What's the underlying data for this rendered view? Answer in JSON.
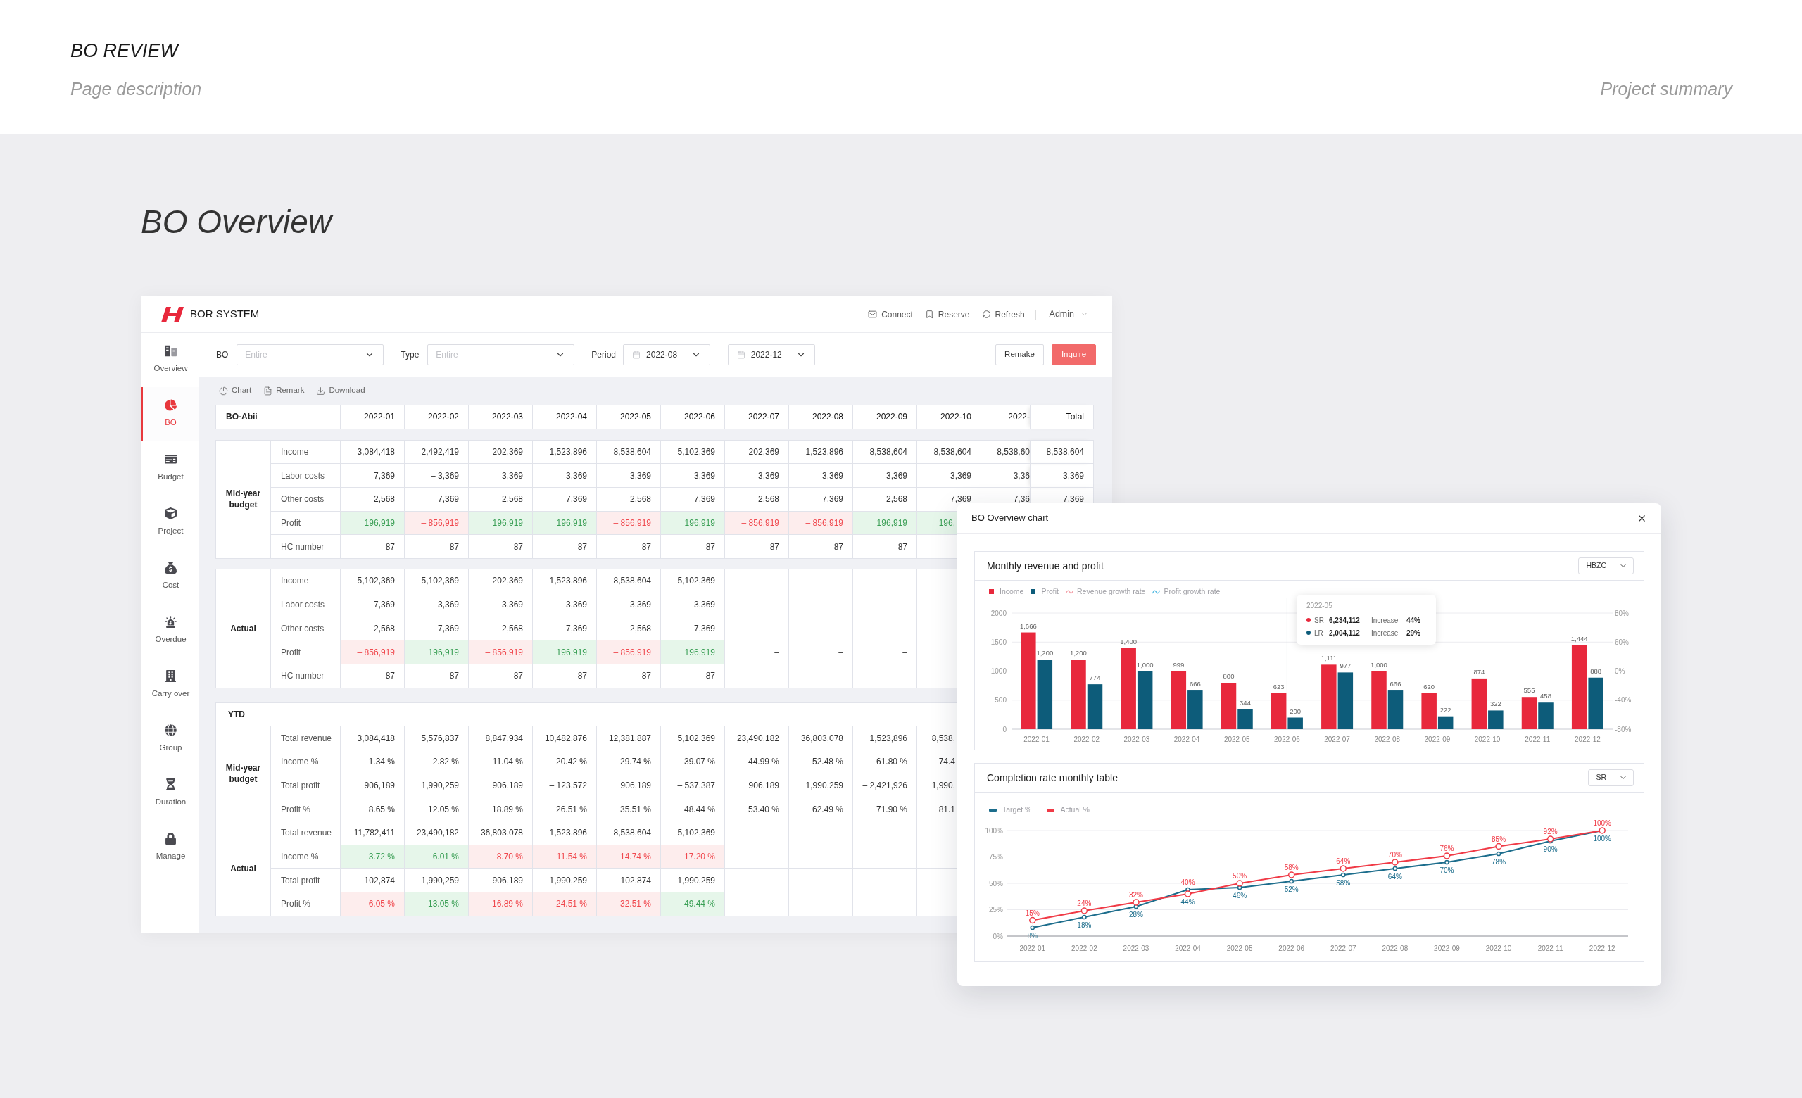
{
  "page": {
    "title": "BO REVIEW",
    "description": "Page description",
    "summary": "Project summary",
    "section_title": "BO Overview"
  },
  "app": {
    "header": {
      "brand": "BOR SYSTEM",
      "actions": [
        "Connect",
        "Reserve",
        "Refresh"
      ],
      "user": "Admin"
    },
    "sidebar": {
      "items": [
        {
          "label": "Overview",
          "selected": false
        },
        {
          "label": "BO",
          "selected": true
        },
        {
          "label": "Budget",
          "selected": false
        },
        {
          "label": "Project",
          "selected": false
        },
        {
          "label": "Cost",
          "selected": false
        },
        {
          "label": "Overdue",
          "selected": false
        },
        {
          "label": "Carry over",
          "selected": false
        },
        {
          "label": "Group",
          "selected": false
        },
        {
          "label": "Duration",
          "selected": false
        },
        {
          "label": "Manage",
          "selected": false
        }
      ]
    },
    "filters": {
      "bo": {
        "label": "BO",
        "placeholder": "Entire"
      },
      "type": {
        "label": "Type",
        "placeholder": "Entire"
      },
      "period": {
        "label": "Period",
        "from": "2022-08",
        "separator": "–",
        "to": "2022-12"
      },
      "buttons": [
        {
          "label": "Remake",
          "kind": "secondary"
        },
        {
          "label": "Inquire",
          "kind": "primary"
        }
      ]
    },
    "toolbar": [
      "Chart",
      "Remark",
      "Download"
    ],
    "table": {
      "columns": [
        "BO-Abii",
        "2022-01",
        "2022-02",
        "2022-03",
        "2022-04",
        "2022-05",
        "2022-06",
        "2022-07",
        "2022-08",
        "2022-09",
        "2022-10",
        "2022-",
        "Total"
      ],
      "blocks": [
        {
          "group": "Mid-year budget",
          "rows": [
            {
              "label": "Income",
              "values": [
                "3,084,418",
                "2,492,419",
                "202,369",
                "1,523,896",
                "8,538,604",
                "5,102,369",
                "202,369",
                "1,523,896",
                "8,538,604",
                "8,538,604",
                "8,538,60",
                "8,538,604"
              ]
            },
            {
              "label": "Labor costs",
              "values": [
                "7,369",
                "– 3,369",
                "3,369",
                "3,369",
                "3,369",
                "3,369",
                "3,369",
                "3,369",
                "3,369",
                "3,369",
                "3,36",
                "3,369"
              ]
            },
            {
              "label": "Other costs",
              "values": [
                "2,568",
                "7,369",
                "2,568",
                "7,369",
                "2,568",
                "7,369",
                "2,568",
                "7,369",
                "2,568",
                "7,369",
                "7,36",
                "7,369"
              ]
            },
            {
              "label": "Profit",
              "values": [
                "196,919",
                "– 856,919",
                "196,919",
                "196,919",
                "– 856,919",
                "196,919",
                "– 856,919",
                "– 856,919",
                "196,919",
                "196,"
              ],
              "positive": [
                true,
                false,
                true,
                true,
                false,
                true,
                false,
                false,
                true,
                true
              ]
            },
            {
              "label": "HC number",
              "values": [
                "87",
                "87",
                "87",
                "87",
                "87",
                "87",
                "87",
                "87",
                "87"
              ]
            }
          ]
        },
        {
          "group": "Actual",
          "rows": [
            {
              "label": "Income",
              "values": [
                "– 5,102,369",
                "5,102,369",
                "202,369",
                "1,523,896",
                "8,538,604",
                "5,102,369",
                "–",
                "–",
                "–"
              ]
            },
            {
              "label": "Labor costs",
              "values": [
                "7,369",
                "– 3,369",
                "3,369",
                "3,369",
                "3,369",
                "3,369",
                "–",
                "–",
                "–"
              ]
            },
            {
              "label": "Other costs",
              "values": [
                "2,568",
                "7,369",
                "2,568",
                "7,369",
                "2,568",
                "7,369",
                "–",
                "–",
                "–"
              ]
            },
            {
              "label": "Profit",
              "values": [
                "– 856,919",
                "196,919",
                "– 856,919",
                "196,919",
                "– 856,919",
                "196,919",
                "–",
                "–",
                "–"
              ],
              "positive": [
                false,
                true,
                false,
                true,
                false,
                true
              ]
            },
            {
              "label": "HC number",
              "values": [
                "87",
                "87",
                "87",
                "87",
                "87",
                "87",
                "–",
                "–",
                "–"
              ]
            }
          ]
        }
      ],
      "ytd": {
        "title": "YTD",
        "groups": [
          {
            "group": "Mid-year budget",
            "rows": [
              {
                "label": "Total revenue",
                "values": [
                  "3,084,418",
                  "5,576,837",
                  "8,847,934",
                  "10,482,876",
                  "12,381,887",
                  "5,102,369",
                  "23,490,182",
                  "36,803,078",
                  "1,523,896",
                  "8,538,"
                ]
              },
              {
                "label": "Income %",
                "values": [
                  "1.34 %",
                  "2.82 %",
                  "11.04 %",
                  "20.42 %",
                  "29.74 %",
                  "39.07 %",
                  "44.99 %",
                  "52.48 %",
                  "61.80 %",
                  "74.4"
                ]
              },
              {
                "label": "Total profit",
                "values": [
                  "906,189",
                  "1,990,259",
                  "906,189",
                  "– 123,572",
                  "906,189",
                  "– 537,387",
                  "906,189",
                  "1,990,259",
                  "– 2,421,926",
                  "1,990,"
                ]
              },
              {
                "label": "Profit %",
                "values": [
                  "8.65 %",
                  "12.05 %",
                  "18.89 %",
                  "26.51 %",
                  "35.51 %",
                  "48.44 %",
                  "53.40 %",
                  "62.49 %",
                  "71.90 %",
                  "81.1"
                ]
              }
            ]
          },
          {
            "group": "Actual",
            "rows": [
              {
                "label": "Total revenue",
                "values": [
                  "11,782,411",
                  "23,490,182",
                  "36,803,078",
                  "1,523,896",
                  "8,538,604",
                  "5,102,369",
                  "–",
                  "–",
                  "–"
                ]
              },
              {
                "label": "Income %",
                "values": [
                  "3.72 %",
                  "6.01 %",
                  "–8.70 %",
                  "–11.54 %",
                  "–14.74 %",
                  "–17.20 %",
                  "–",
                  "–",
                  "–"
                ],
                "positive": [
                  true,
                  true,
                  false,
                  false,
                  false,
                  false
                ]
              },
              {
                "label": "Total profit",
                "values": [
                  "– 102,874",
                  "1,990,259",
                  "906,189",
                  "1,990,259",
                  "– 102,874",
                  "1,990,259",
                  "–",
                  "–",
                  "–"
                ]
              },
              {
                "label": "Profit %",
                "values": [
                  "–6.05 %",
                  "13.05 %",
                  "–16.89 %",
                  "–24.51 %",
                  "–32.51 %",
                  "49.44 %",
                  "–",
                  "–",
                  "–"
                ],
                "positive": [
                  false,
                  true,
                  false,
                  false,
                  false,
                  true
                ]
              }
            ]
          }
        ]
      }
    }
  },
  "dialog": {
    "title": "BO Overview chart",
    "cards": [
      {
        "title": "Monthly revenue and profit",
        "select": "HBZC",
        "extra_legend": [
          {
            "label": "Revenue growth rate",
            "color": "#f4a3ab"
          },
          {
            "label": "Profit growth rate",
            "color": "#5bbde3"
          }
        ],
        "right_axis_labels": [
          "80%",
          "60%",
          "0%",
          "-40%",
          "-80%"
        ],
        "tooltip": {
          "title": "2022-05",
          "rows": [
            {
              "label": "SR",
              "value": "6,234,112",
              "change_label": "Increase",
              "change": "44%",
              "color": "#e8283c"
            },
            {
              "label": "LR",
              "value": "2,004,112",
              "change_label": "Increase",
              "change": "29%",
              "color": "#0d5c7a"
            }
          ]
        },
        "chart_data": {
          "type": "bar",
          "categories": [
            "2022-01",
            "2022-02",
            "2022-03",
            "2022-04",
            "2022-05",
            "2022-06",
            "2022-07",
            "2022-08",
            "2022-09",
            "2022-10",
            "2022-11",
            "2022-12"
          ],
          "series": [
            {
              "name": "Income",
              "color": "#e8283c",
              "values": [
                1666,
                1200,
                1400,
                999,
                800,
                623,
                1111,
                1000,
                620,
                874,
                555,
                1444
              ],
              "value_labels": [
                "1,666",
                "1,200",
                "1,400",
                "999",
                "800",
                "623",
                "1,111",
                "1,000",
                "620",
                "874",
                "555",
                "1,444"
              ]
            },
            {
              "name": "Profit",
              "color": "#0d5c7a",
              "values": [
                1200,
                774,
                1000,
                666,
                344,
                200,
                977,
                666,
                222,
                322,
                458,
                888
              ],
              "value_labels": [
                "1,200",
                "774",
                "1,000",
                "666",
                "344",
                "200",
                "977",
                "666",
                "222",
                "322",
                "458",
                "888"
              ]
            }
          ],
          "ylim": [
            0,
            2000
          ],
          "yticks": [
            0,
            500,
            1000,
            1500,
            2000
          ],
          "ref_lines": [
            {
              "axis": "x",
              "value": "2022-06",
              "color": "#d5d6dc",
              "line_style": "solid"
            }
          ],
          "data_labels": true,
          "grid": true,
          "legend": "top-left"
        }
      },
      {
        "title": "Completion rate monthly table",
        "select": "SR",
        "chart_data": {
          "type": "line",
          "categories": [
            "2022-01",
            "2022-02",
            "2022-03",
            "2022-04",
            "2022-05",
            "2022-06",
            "2022-07",
            "2022-08",
            "2022-09",
            "2022-10",
            "2022-11",
            "2022-12"
          ],
          "series": [
            {
              "name": "Target %",
              "color": "#1c6d8c",
              "values": [
                8,
                18,
                28,
                44,
                46,
                52,
                58,
                64,
                70,
                78,
                90,
                100
              ],
              "value_labels": [
                "8%",
                "18%",
                "28%",
                "44%",
                "46%",
                "52%",
                "58%",
                "64%",
                "70%",
                "78%",
                "90%",
                "100%"
              ]
            },
            {
              "name": "Actual %",
              "color": "#f03a46",
              "values": [
                15,
                24,
                32,
                40,
                50,
                58,
                64,
                70,
                76,
                85,
                92,
                100
              ],
              "value_labels": [
                "15%",
                "24%",
                "32%",
                "40%",
                "50%",
                "58%",
                "64%",
                "70%",
                "76%",
                "85%",
                "92%",
                "100%"
              ]
            }
          ],
          "ylim": [
            0,
            100
          ],
          "yticks": [
            {
              "value": 0,
              "label": "0%"
            },
            {
              "value": 25,
              "label": "25%"
            },
            {
              "value": 50,
              "label": "50%"
            },
            {
              "value": 75,
              "label": "75%"
            },
            {
              "value": 100,
              "label": "100%"
            }
          ],
          "data_labels": true,
          "marker": "circle",
          "grid": true,
          "legend": "top-left"
        }
      }
    ]
  }
}
